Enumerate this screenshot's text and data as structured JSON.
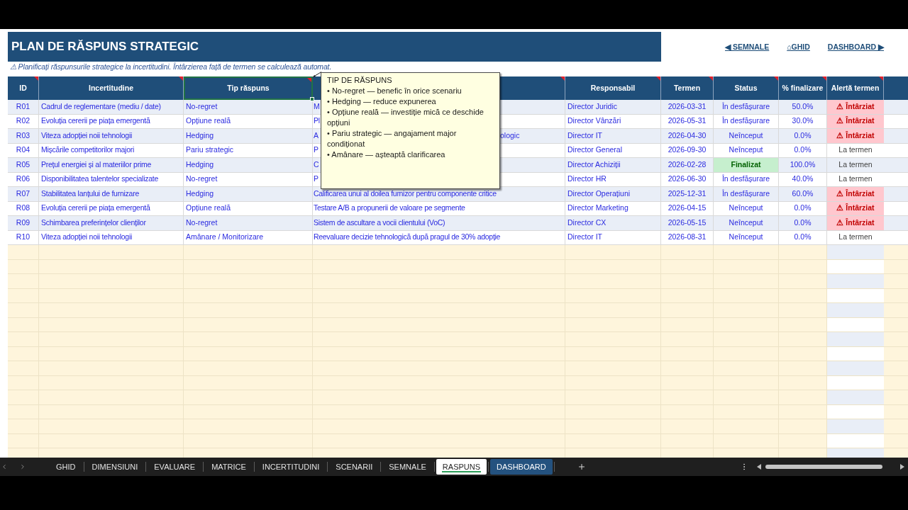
{
  "header": {
    "title": "PLAN DE RĂSPUNS STRATEGIC",
    "links": [
      "◀ SEMNALE",
      "⌂GHID",
      "DASHBOARD ▶"
    ]
  },
  "subtitle": "⚠ Planificați răspunsurile strategice la incertitudini. Întârzierea față de termen se calculează automat.",
  "table": {
    "columns": [
      {
        "label": "ID",
        "selected": false
      },
      {
        "label": "Incertitudine",
        "selected": false
      },
      {
        "label": "Tip răspuns",
        "selected": true
      },
      {
        "selected": false
      },
      {
        "label": "Responsabil",
        "selected": false
      },
      {
        "label": "Termen",
        "selected": false
      },
      {
        "label": "Status",
        "selected": false
      },
      {
        "label": "% finalizare",
        "selected": false
      },
      {
        "label": "Alertă termen",
        "selected": false
      }
    ],
    "rows": [
      {
        "id": "R01",
        "uncertainty": "Cadrul de reglementare (mediu / date)",
        "response_type": "No-regret",
        "action": "M",
        "owner": "Director Juridic",
        "deadline": "2026-03-31",
        "status": {
          "text": "În desfășurare",
          "kind": "open"
        },
        "completion": "50.0%",
        "alert": {
          "text": "⚠ Întârziat",
          "kind": "late"
        }
      },
      {
        "id": "R02",
        "uncertainty": "Evoluția cererii pe piața emergentă",
        "response_type": "Opțiune reală",
        "action": "Pl",
        "owner": "Director Vânzări",
        "deadline": "2026-05-31",
        "status": {
          "text": "În desfășurare",
          "kind": "open"
        },
        "completion": "30.0%",
        "alert": {
          "text": "⚠ Întârziat",
          "kind": "late"
        }
      },
      {
        "id": "R03",
        "uncertainty": "Viteza adopției noii tehnologii",
        "response_type": "Hedging",
        "action": "A",
        "action_tail": "ologic",
        "owner": "Director IT",
        "deadline": "2026-04-30",
        "status": {
          "text": "Neînceput",
          "kind": "open"
        },
        "completion": "0.0%",
        "alert": {
          "text": "⚠ Întârziat",
          "kind": "late"
        }
      },
      {
        "id": "R04",
        "uncertainty": "Mișcările competitorilor majori",
        "response_type": "Pariu strategic",
        "action": "P",
        "owner": "Director General",
        "deadline": "2026-09-30",
        "status": {
          "text": "Neînceput",
          "kind": "open"
        },
        "completion": "0.0%",
        "alert": {
          "text": "La termen",
          "kind": "on_time"
        }
      },
      {
        "id": "R05",
        "uncertainty": "Prețul energiei și al materiilor prime",
        "response_type": "Hedging",
        "action": "C",
        "owner": "Director Achiziții",
        "deadline": "2026-02-28",
        "status": {
          "text": "Finalizat",
          "kind": "done"
        },
        "completion": "100.0%",
        "alert": {
          "text": "La termen",
          "kind": "on_time"
        }
      },
      {
        "id": "R06",
        "uncertainty": "Disponibilitatea talentelor specializate",
        "response_type": "No-regret",
        "action": "P",
        "owner": "Director HR",
        "deadline": "2026-06-30",
        "status": {
          "text": "În desfășurare",
          "kind": "open"
        },
        "completion": "40.0%",
        "alert": {
          "text": "La termen",
          "kind": "on_time"
        }
      },
      {
        "id": "R07",
        "uncertainty": "Stabilitatea lanțului de furnizare",
        "response_type": "Hedging",
        "action": "Calificarea unui al doilea furnizor pentru componente critice",
        "owner": "Director Operațiuni",
        "deadline": "2025-12-31",
        "status": {
          "text": "În desfășurare",
          "kind": "open"
        },
        "completion": "60.0%",
        "alert": {
          "text": "⚠ Întârziat",
          "kind": "late"
        }
      },
      {
        "id": "R08",
        "uncertainty": "Evoluția cererii pe piața emergentă",
        "response_type": "Opțiune reală",
        "action": "Testare A/B a propunerii de valoare pe segmente",
        "owner": "Director Marketing",
        "deadline": "2026-04-15",
        "status": {
          "text": "Neînceput",
          "kind": "open"
        },
        "completion": "0.0%",
        "alert": {
          "text": "⚠ Întârziat",
          "kind": "late"
        }
      },
      {
        "id": "R09",
        "uncertainty": "Schimbarea preferințelor clienților",
        "response_type": "No-regret",
        "action": "Sistem de ascultare a vocii clientului (VoC)",
        "owner": "Director CX",
        "deadline": "2026-05-15",
        "status": {
          "text": "Neînceput",
          "kind": "open"
        },
        "completion": "0.0%",
        "alert": {
          "text": "⚠ Întârziat",
          "kind": "late"
        }
      },
      {
        "id": "R10",
        "uncertainty": "Viteza adopției noii tehnologii",
        "response_type": "Amânare / Monitorizare",
        "action": "Reevaluare decizie tehnologică după pragul de 30% adopție",
        "owner": "Director IT",
        "deadline": "2026-08-31",
        "status": {
          "text": "Neînceput",
          "kind": "open"
        },
        "completion": "0.0%",
        "alert": {
          "text": "La termen",
          "kind": "on_time"
        }
      }
    ]
  },
  "comment": {
    "title": "TIP DE RĂSPUNS",
    "lines": [
      "• No-regret — benefic în orice scenariu",
      "• Hedging — reduce expunerea",
      "• Opțiune reală — investiție mică ce deschide opțiuni",
      "• Pariu strategic — angajament major condiționat",
      "• Amânare — așteaptă clarificarea"
    ]
  },
  "sheet_tabs": [
    {
      "label": "GHID",
      "selected": false
    },
    {
      "label": "DIMENSIUNI",
      "selected": false
    },
    {
      "label": "EVALUARE",
      "selected": false
    },
    {
      "label": "MATRICE",
      "selected": false
    },
    {
      "label": "INCERTITUDINI",
      "selected": false
    },
    {
      "label": "SCENARII",
      "selected": false
    },
    {
      "label": "SEMNALE",
      "selected": false
    },
    {
      "label": "RASPUNS",
      "selected": true
    },
    {
      "label": "DASHBOARD",
      "selected": false,
      "color": "#24527f"
    }
  ]
}
